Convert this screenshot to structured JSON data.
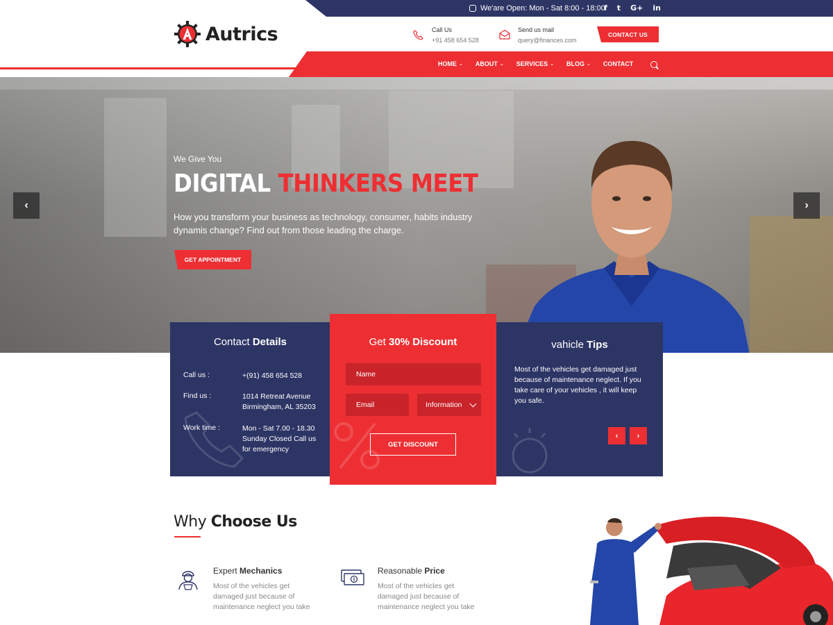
{
  "topbar": {
    "open_hours": "We'are Open: Mon - Sat 8:00 - 18:00",
    "socials": [
      "f",
      "t",
      "G+",
      "in"
    ]
  },
  "header": {
    "logo_text": "Autrics",
    "call": {
      "title": "Call Us",
      "value": "+91 458 654 528"
    },
    "mail": {
      "title": "Send us mail",
      "value": "query@finances.com"
    },
    "contact_button": "CONTACT US"
  },
  "nav": {
    "items": [
      {
        "label": "HOME",
        "dropdown": true
      },
      {
        "label": "ABOUT",
        "dropdown": true
      },
      {
        "label": "SERVICES",
        "dropdown": true
      },
      {
        "label": "BLOG",
        "dropdown": true
      },
      {
        "label": "CONTACT",
        "dropdown": false
      }
    ]
  },
  "hero": {
    "subtitle": "We Give You",
    "title_white": "DIGITAL ",
    "title_red": "THINKERS MEET",
    "description": "How you transform your business as technology, consumer, habits industry dynamis change? Find out from those leading the charge.",
    "button": "GET APPOINTMENT",
    "prev": "‹",
    "next": "›"
  },
  "contact_box": {
    "title_light": "Contact ",
    "title_bold": "Details",
    "rows": [
      {
        "label": "Call us :",
        "value": "+(91) 458 654 528"
      },
      {
        "label": "Find us :",
        "value": "1014 Retreat Avenue Birmingham, AL 35203"
      },
      {
        "label": "Work time :",
        "value": "Mon - Sat 7.00 - 18.30 Sunday Closed Call us for emergency"
      }
    ]
  },
  "discount_box": {
    "title_light": "Get ",
    "title_bold": "30% Discount",
    "name_placeholder": "Name",
    "email_placeholder": "Email",
    "select_value": "Information",
    "button": "GET DISCOUNT"
  },
  "tips_box": {
    "title_light": "vahicle ",
    "title_bold": "Tips",
    "text": "Most of the vehicles get damaged just because of maintenance neglect. If you take care of your vehicles , it will keep you safe.",
    "prev": "‹",
    "next": "›"
  },
  "why": {
    "title_light": "Why ",
    "title_bold": "Choose Us",
    "features": [
      {
        "title_light": "Expert ",
        "title_bold": "Mechanics",
        "desc": "Most of the vehicles get damaged just because of maintenance neglect you take",
        "icon": "mechanic-icon"
      },
      {
        "title_light": "Reasonable ",
        "title_bold": "Price",
        "desc": "Most of the vehicles get damaged just because of maintenance neglect you take",
        "icon": "money-icon"
      }
    ]
  },
  "colors": {
    "primary_red": "#ed2f33",
    "navy": "#2d3565"
  }
}
